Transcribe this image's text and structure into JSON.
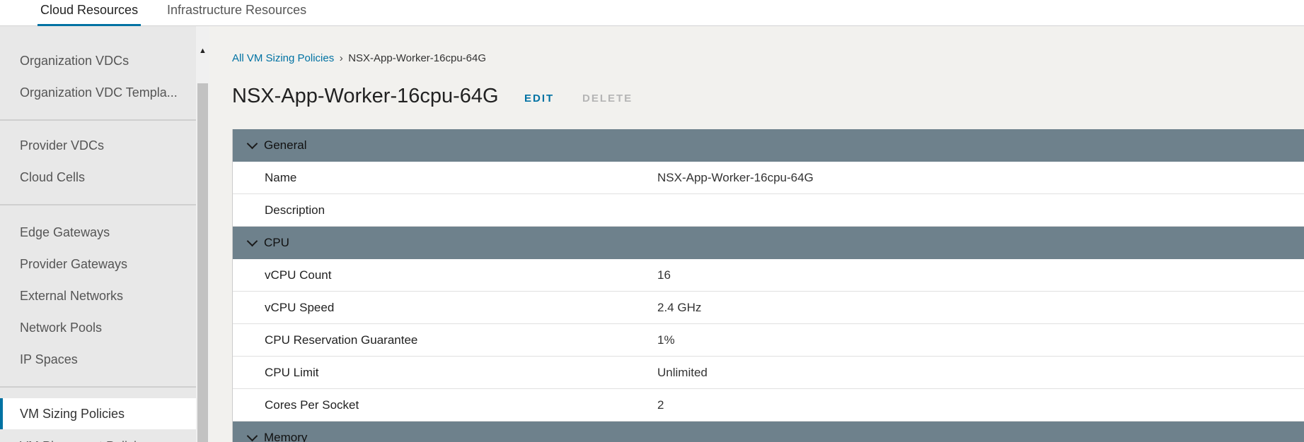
{
  "topnav": {
    "tabs": [
      {
        "label": "Cloud Resources",
        "active": true
      },
      {
        "label": "Infrastructure Resources",
        "active": false
      }
    ]
  },
  "sidebar": {
    "items": [
      {
        "label": "Organization VDCs"
      },
      {
        "label": "Organization VDC Templa..."
      },
      {
        "label": "Provider VDCs"
      },
      {
        "label": "Cloud Cells"
      },
      {
        "label": "Edge Gateways"
      },
      {
        "label": "Provider Gateways"
      },
      {
        "label": "External Networks"
      },
      {
        "label": "Network Pools"
      },
      {
        "label": "IP Spaces"
      },
      {
        "label": "VM Sizing Policies",
        "active": true
      },
      {
        "label": "VM Placement Policies"
      }
    ]
  },
  "breadcrumb": {
    "parent": "All VM Sizing Policies",
    "separator": "›",
    "current": "NSX-App-Worker-16cpu-64G"
  },
  "page": {
    "title": "NSX-App-Worker-16cpu-64G",
    "edit_label": "EDIT",
    "delete_label": "DELETE"
  },
  "sections": {
    "general": {
      "title": "General",
      "rows": [
        {
          "label": "Name",
          "value": "NSX-App-Worker-16cpu-64G"
        },
        {
          "label": "Description",
          "value": ""
        }
      ]
    },
    "cpu": {
      "title": "CPU",
      "rows": [
        {
          "label": "vCPU Count",
          "value": "16"
        },
        {
          "label": "vCPU Speed",
          "value": "2.4 GHz"
        },
        {
          "label": "CPU Reservation Guarantee",
          "value": "1%"
        },
        {
          "label": "CPU Limit",
          "value": "Unlimited"
        },
        {
          "label": "Cores Per Socket",
          "value": "2"
        }
      ]
    },
    "memory": {
      "title": "Memory"
    }
  },
  "colors": {
    "accent": "#0072a3",
    "section_header": "#6e818c"
  },
  "icons": {
    "scroll_up": "scroll-up-arrow-icon",
    "chevron": "chevron-down-icon",
    "breadcrumb_sep": "chevron-right-icon"
  }
}
